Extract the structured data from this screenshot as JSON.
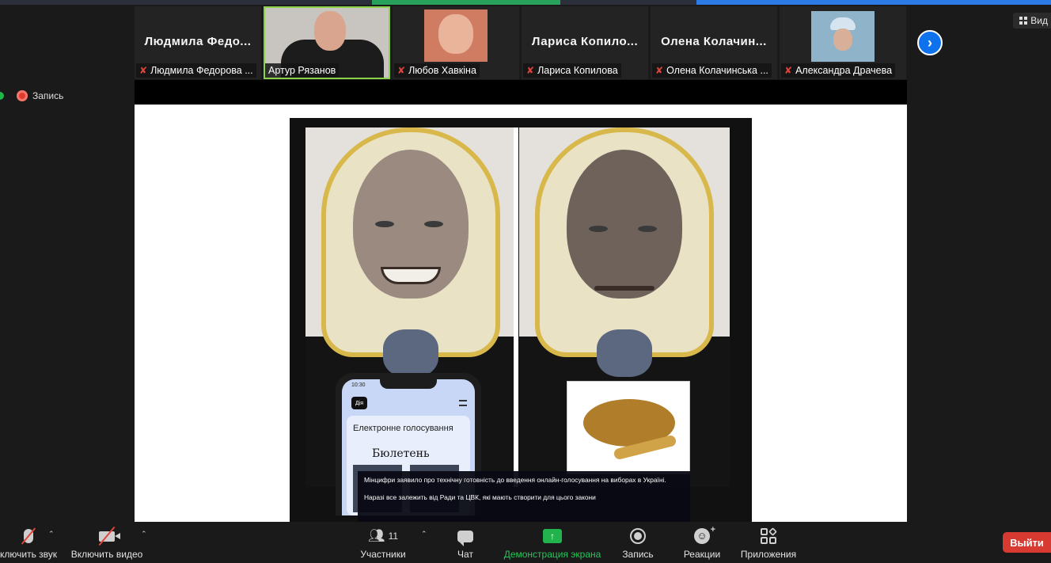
{
  "top_bar": {
    "colors": [
      "#27a15b",
      "#2d7be5"
    ]
  },
  "view_button": {
    "label": "Вид"
  },
  "recording": {
    "label": "Запись"
  },
  "participants_strip": [
    {
      "display_name": "Людмила  Федо...",
      "label": "Людмила Федорова ...",
      "muted": true,
      "video": false
    },
    {
      "display_name": "",
      "label": "Артур Рязанов",
      "muted": false,
      "video": true,
      "active_speaker": true
    },
    {
      "display_name": "",
      "label": "Любов Хавкіна",
      "muted": true,
      "video": true
    },
    {
      "display_name": "Лариса  Копило...",
      "label": "Лариса Копилова",
      "muted": true,
      "video": false
    },
    {
      "display_name": "Олена  Колачин...",
      "label": "Олена Колачинська ...",
      "muted": true,
      "video": false
    },
    {
      "display_name": "",
      "label": "Александра Драчева",
      "muted": true,
      "video": true
    }
  ],
  "shared_screen": {
    "phone": {
      "time": "10:30",
      "app_badge": "Дія",
      "heading": "Електронне голосування",
      "ballot": "Бюлетень"
    },
    "caption": {
      "line1": "Мінцифри заявило про технічну готовність до введення онлайн-голосування на виборах в Україні.",
      "line2": "Наразі все залежить від Ради та ЦВК, які мають створити для цього закони"
    }
  },
  "toolbar": {
    "mute_label": "ключить звук",
    "video_label": "Включить видео",
    "participants_label": "Участники",
    "participants_count": "11",
    "chat_label": "Чат",
    "share_label": "Демонстрация экрана",
    "record_label": "Запись",
    "reactions_label": "Реакции",
    "apps_label": "Приложения",
    "leave_label": "Выйти"
  },
  "colors": {
    "accent_blue": "#0e72ed",
    "share_green": "#27c45b",
    "leave_red": "#d63a30",
    "muted_red": "#e0443a",
    "active_border": "#8bd14a"
  }
}
